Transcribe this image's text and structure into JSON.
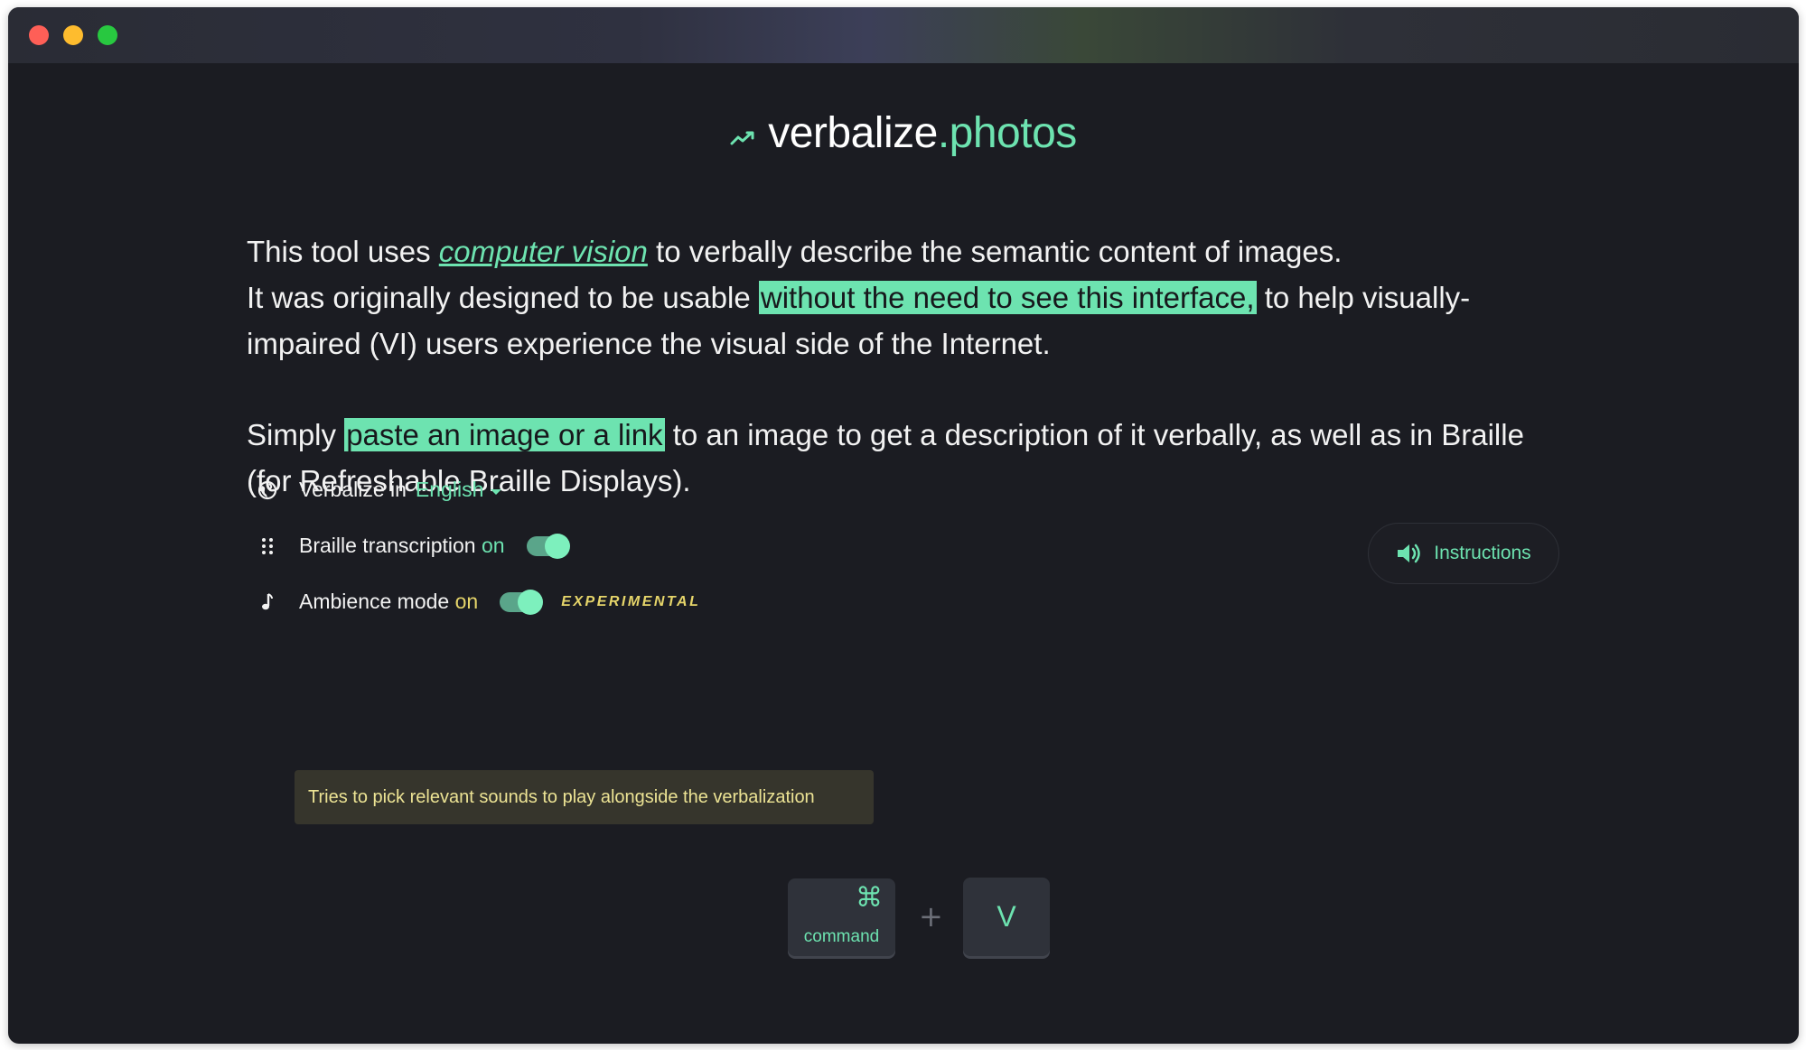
{
  "window": {
    "controls": [
      "close",
      "minimize",
      "maximize"
    ]
  },
  "brand": {
    "icon": "trending-line-icon",
    "name": "verbalize",
    "tld": ".photos"
  },
  "intro": {
    "p1_before": "This tool uses ",
    "p1_link": "computer vision",
    "p1_after": " to verbally describe the semantic content of images.",
    "p1_line2_before": "It was originally designed to be usable ",
    "p1_highlight": "without the need to see this interface,",
    "p1_line2_after": " to help visually-impaired (VI) users experience the visual side of the Internet.",
    "p2_before": "Simply ",
    "p2_highlight": "paste an image or a link",
    "p2_after": " to an image to get a description of it verbally, as well as in Braille (for Refreshable Braille Displays)."
  },
  "instructions": {
    "icon": "speaker-icon",
    "label": "Instructions"
  },
  "settings": {
    "language": {
      "icon": "globe-icon",
      "label": "Verbalize in",
      "value": "English"
    },
    "braille": {
      "icon": "braille-dots-icon",
      "label": "Braille transcription",
      "state": "on",
      "enabled": true
    },
    "ambience": {
      "icon": "music-note-icon",
      "label": "Ambience mode",
      "state": "on",
      "enabled": true,
      "badge": "EXPERIMENTAL",
      "tooltip": "Tries to pick relevant sounds to play alongside the verbalization"
    }
  },
  "shortcut": {
    "modifier_glyph": "⌘",
    "modifier_label": "command",
    "plus": "+",
    "key": "V"
  },
  "colors": {
    "accent": "#6de3b0",
    "background": "#1b1c22",
    "experimental": "#e6d56a"
  }
}
